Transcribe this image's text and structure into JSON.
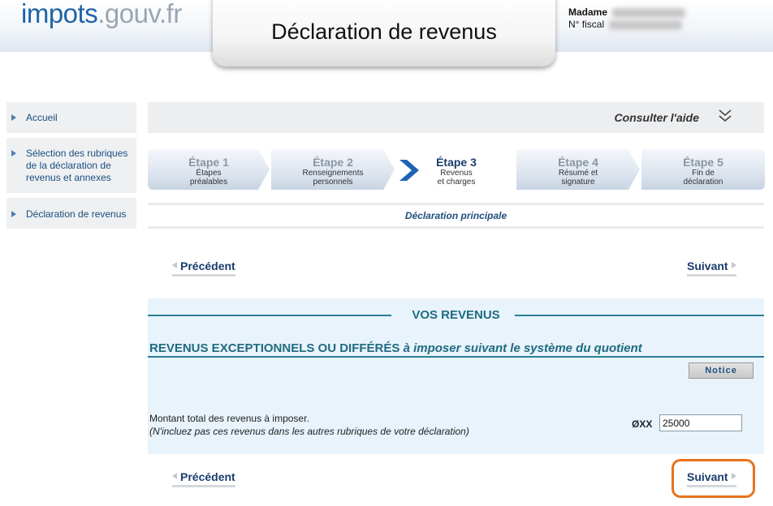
{
  "header": {
    "logo_main": "impots",
    "logo_domain": ".gouv.fr",
    "page_title": "Déclaration de revenus",
    "user_title": "Madame",
    "fiscal_label": "N° fiscal"
  },
  "sidebar": {
    "items": [
      {
        "label": "Accueil"
      },
      {
        "label": "Sélection des rubriques de la déclaration de revenus et annexes"
      },
      {
        "label": "Déclaration de revenus"
      }
    ]
  },
  "help": {
    "label": "Consulter l'aide"
  },
  "steps": [
    {
      "title": "Étape 1",
      "sub1": "Étapes",
      "sub2": "préalables",
      "current": false
    },
    {
      "title": "Étape 2",
      "sub1": "Renseignements",
      "sub2": "personnels",
      "current": false
    },
    {
      "title": "Étape 3",
      "sub1": "Revenus",
      "sub2": "et charges",
      "current": true
    },
    {
      "title": "Étape 4",
      "sub1": "Résumé et",
      "sub2": "signature",
      "current": false
    },
    {
      "title": "Étape 5",
      "sub1": "Fin de",
      "sub2": "déclaration",
      "current": false
    }
  ],
  "declaration": {
    "label": "Déclaration principale"
  },
  "nav": {
    "previous": "Précédent",
    "next": "Suivant"
  },
  "revenus": {
    "section_title": "VOS REVENUS",
    "subhead_bold": "REVENUS EXCEPTIONNELS OU DIFFÉRÉS",
    "subhead_italic": "à imposer suivant le système du quotient",
    "notice_label": "Notice",
    "amount_label": "Montant total des revenus à imposer.",
    "amount_note": "(N'incluez pas ces revenus dans les autres rubriques de votre déclaration)",
    "code": "ØXX",
    "amount_value": "25000"
  },
  "colors": {
    "brand_blue": "#1f63a8",
    "section_teal": "#1f6b80",
    "highlight": "#e8731e"
  },
  "icons": {
    "help_expand": "double-chevron-down-icon",
    "current_step": "chevron-right-icon"
  }
}
